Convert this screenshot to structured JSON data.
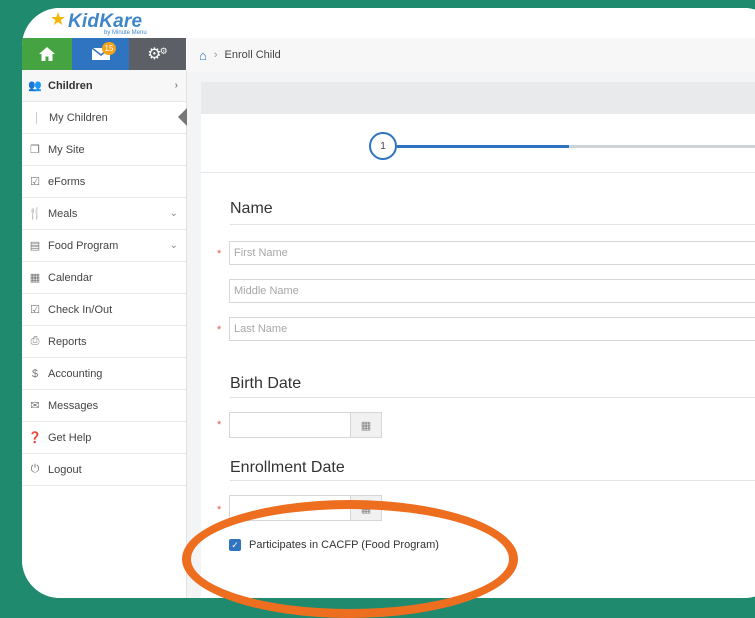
{
  "brand": {
    "name": "KidKare",
    "tagline": "by Minute Menu"
  },
  "nav_icons": {
    "home_icon": "home-icon",
    "mail_icon": "mail-icon",
    "mail_badge": "15",
    "settings_icon": "gear-icon"
  },
  "breadcrumb": {
    "home_icon": "home-icon",
    "current": "Enroll Child"
  },
  "sidebar": {
    "items": [
      {
        "label": "Children",
        "icon": "children-icon",
        "active": true,
        "chevron": "›"
      },
      {
        "label": "My Children",
        "sub": true
      },
      {
        "label": "My Site",
        "icon": "site-icon"
      },
      {
        "label": "eForms",
        "icon": "eforms-icon"
      },
      {
        "label": "Meals",
        "icon": "meals-icon",
        "chevron": "⌄"
      },
      {
        "label": "Food Program",
        "icon": "food-program-icon",
        "chevron": "⌄"
      },
      {
        "label": "Calendar",
        "icon": "calendar-icon"
      },
      {
        "label": "Check In/Out",
        "icon": "checkin-icon"
      },
      {
        "label": "Reports",
        "icon": "reports-icon"
      },
      {
        "label": "Accounting",
        "icon": "dollar-icon"
      },
      {
        "label": "Messages",
        "icon": "messages-icon"
      },
      {
        "label": "Get Help",
        "icon": "help-icon"
      },
      {
        "label": "Logout",
        "icon": "power-icon"
      }
    ]
  },
  "wizard": {
    "step_number": "1"
  },
  "form": {
    "name_section": "Name",
    "first_name_placeholder": "First Name",
    "middle_name_placeholder": "Middle Name",
    "last_name_placeholder": "Last Name",
    "birth_section": "Birth Date",
    "enrollment_section": "Enrollment Date",
    "required_mark": "*",
    "cacfp_label": "Participates in CACFP (Food Program)",
    "cacfp_checked": true
  },
  "colors": {
    "background": "#1f8a6e",
    "accent_blue": "#2f74c0",
    "home_green": "#45a341",
    "highlight": "#ee6e1f"
  }
}
